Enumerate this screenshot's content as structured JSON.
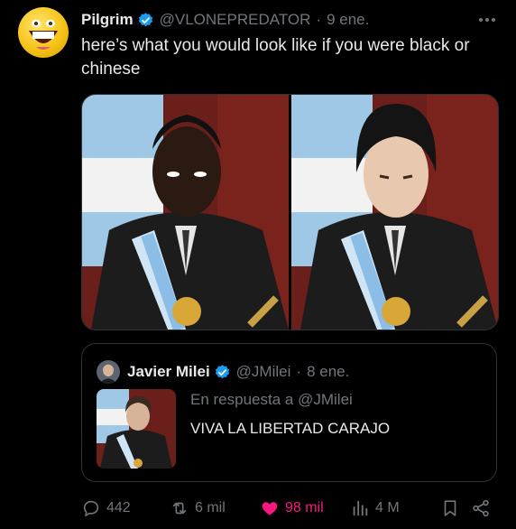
{
  "tweet": {
    "author_name": "Pilgrim",
    "author_handle": "@VLONEPREDATOR",
    "separator": "·",
    "date": "9 ene.",
    "text": "here’s what you would look like if you were black or chinese"
  },
  "quote": {
    "author_name": "Javier Milei",
    "author_handle": "@JMilei",
    "separator": "·",
    "date": "8 ene.",
    "reply_prefix": "En respuesta a",
    "reply_to": "@JMilei",
    "text": "VIVA LA LIBERTAD CARAJO"
  },
  "actions": {
    "replies": "442",
    "reposts": "6 mil",
    "likes": "98 mil",
    "views": "4 M"
  },
  "icons": {
    "verified": "verified-badge-icon",
    "more": "more-dots-icon",
    "reply": "reply-icon",
    "repost": "repost-icon",
    "like": "heart-icon",
    "views": "views-icon",
    "bookmark": "bookmark-icon",
    "share": "share-icon"
  },
  "colors": {
    "background": "#000000",
    "verified": "#1d9bf0",
    "like": "#f91880",
    "muted": "#71767b"
  }
}
